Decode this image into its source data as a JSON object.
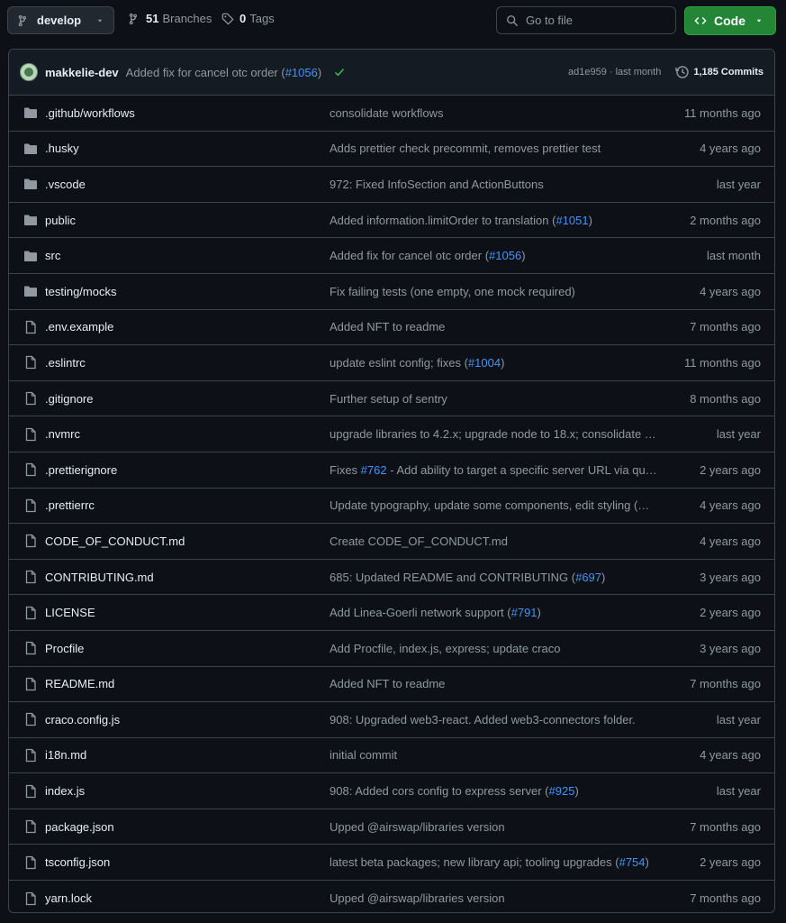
{
  "toolbar": {
    "branch": "develop",
    "branches_count": "51",
    "branches_label": "Branches",
    "tags_count": "0",
    "tags_label": "Tags",
    "search_placeholder": "Go to file",
    "code_label": "Code"
  },
  "latest_commit": {
    "author": "makkelie-dev",
    "message": "Added fix for cancel otc order (",
    "pr": "#1056",
    "message_end": ")",
    "status": "success",
    "sha": "ad1e959",
    "separator": " · ",
    "time": "last month",
    "commits_count": "1,185 Commits"
  },
  "files": [
    {
      "type": "folder",
      "name": ".github/workflows",
      "msg": "consolidate workflows",
      "pr": "",
      "msg_end": "",
      "age": "11 months ago"
    },
    {
      "type": "folder",
      "name": ".husky",
      "msg": "Adds prettier check precommit, removes prettier test",
      "pr": "",
      "msg_end": "",
      "age": "4 years ago"
    },
    {
      "type": "folder",
      "name": ".vscode",
      "msg": "972: Fixed InfoSection and ActionButtons",
      "pr": "",
      "msg_end": "",
      "age": "last year"
    },
    {
      "type": "folder",
      "name": "public",
      "msg": "Added information.limitOrder to translation (",
      "pr": "#1051",
      "msg_end": ")",
      "age": "2 months ago"
    },
    {
      "type": "folder",
      "name": "src",
      "msg": "Added fix for cancel otc order (",
      "pr": "#1056",
      "msg_end": ")",
      "age": "last month"
    },
    {
      "type": "folder",
      "name": "testing/mocks",
      "msg": "Fix failing tests (one empty, one mock required)",
      "pr": "",
      "msg_end": "",
      "age": "4 years ago"
    },
    {
      "type": "file",
      "name": ".env.example",
      "msg": "Added NFT to readme",
      "pr": "",
      "msg_end": "",
      "age": "7 months ago"
    },
    {
      "type": "file",
      "name": ".eslintrc",
      "msg": "update eslint config; fixes (",
      "pr": "#1004",
      "msg_end": ")",
      "age": "11 months ago"
    },
    {
      "type": "file",
      "name": ".gitignore",
      "msg": "Further setup of sentry",
      "pr": "",
      "msg_end": "",
      "age": "8 months ago"
    },
    {
      "type": "file",
      "name": ".nvmrc",
      "msg": "upgrade libraries to 4.2.x; upgrade node to 18.x; consolidate …",
      "pr": "",
      "msg_end": "",
      "age": "last year"
    },
    {
      "type": "file",
      "name": ".prettierignore",
      "msg": "Fixes ",
      "pr": "#762",
      "msg_end": " - Add ability to target a specific server URL via qu…",
      "age": "2 years ago"
    },
    {
      "type": "file",
      "name": ".prettierrc",
      "msg": "Update typography, update some components, edit styling (…",
      "pr": "",
      "msg_end": "",
      "age": "4 years ago"
    },
    {
      "type": "file",
      "name": "CODE_OF_CONDUCT.md",
      "msg": "Create CODE_OF_CONDUCT.md",
      "pr": "",
      "msg_end": "",
      "age": "4 years ago"
    },
    {
      "type": "file",
      "name": "CONTRIBUTING.md",
      "msg": "685: Updated README and CONTRIBUTING (",
      "pr": "#697",
      "msg_end": ")",
      "age": "3 years ago"
    },
    {
      "type": "file",
      "name": "LICENSE",
      "msg": "Add Linea-Goerli network support (",
      "pr": "#791",
      "msg_end": ")",
      "age": "2 years ago"
    },
    {
      "type": "file",
      "name": "Procfile",
      "msg": "Add Procfile, index.js, express; update craco",
      "pr": "",
      "msg_end": "",
      "age": "3 years ago"
    },
    {
      "type": "file",
      "name": "README.md",
      "msg": "Added NFT to readme",
      "pr": "",
      "msg_end": "",
      "age": "7 months ago"
    },
    {
      "type": "file",
      "name": "craco.config.js",
      "msg": "908: Upgraded web3-react. Added web3-connectors folder.",
      "pr": "",
      "msg_end": "",
      "age": "last year"
    },
    {
      "type": "file",
      "name": "i18n.md",
      "msg": "initial commit",
      "pr": "",
      "msg_end": "",
      "age": "4 years ago"
    },
    {
      "type": "file",
      "name": "index.js",
      "msg": "908: Added cors config to express server (",
      "pr": "#925",
      "msg_end": ")",
      "age": "last year"
    },
    {
      "type": "file",
      "name": "package.json",
      "msg": "Upped @airswap/libraries version",
      "pr": "",
      "msg_end": "",
      "age": "7 months ago"
    },
    {
      "type": "file",
      "name": "tsconfig.json",
      "msg": "latest beta packages; new library api; tooling upgrades (",
      "pr": "#754",
      "msg_end": ")",
      "age": "2 years ago"
    },
    {
      "type": "file",
      "name": "yarn.lock",
      "msg": "Upped @airswap/libraries version",
      "pr": "",
      "msg_end": "",
      "age": "7 months ago"
    }
  ],
  "colors": {
    "background": "#0d1117",
    "border": "#3d444d",
    "link": "#4493f8",
    "muted": "#9198a1",
    "success": "#3fb950",
    "code_button": "#238636"
  }
}
